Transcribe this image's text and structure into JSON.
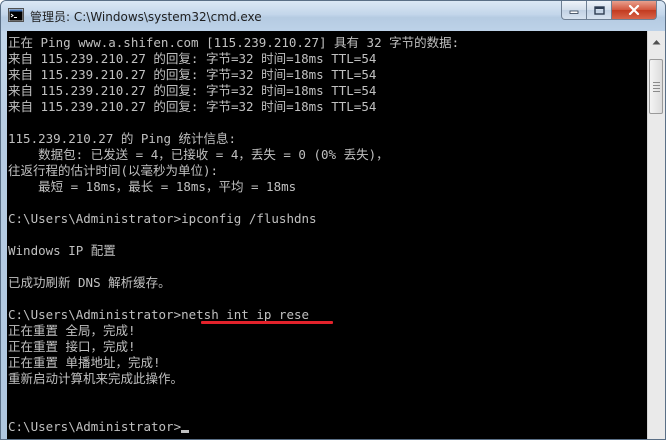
{
  "window": {
    "title": "管理员: C:\\Windows\\system32\\cmd.exe",
    "icon": "cmd-icon"
  },
  "title_buttons": {
    "minimize": "minimize-icon",
    "maximize": "maximize-icon",
    "close": "close-icon"
  },
  "console": {
    "lines": [
      "正在 Ping www.a.shifen.com [115.239.210.27] 具有 32 字节的数据:",
      "来自 115.239.210.27 的回复: 字节=32 时间=18ms TTL=54",
      "来自 115.239.210.27 的回复: 字节=32 时间=18ms TTL=54",
      "来自 115.239.210.27 的回复: 字节=32 时间=18ms TTL=54",
      "来自 115.239.210.27 的回复: 字节=32 时间=18ms TTL=54",
      "",
      "115.239.210.27 的 Ping 统计信息:",
      "    数据包: 已发送 = 4，已接收 = 4，丢失 = 0 (0% 丢失)，",
      "往返行程的估计时间(以毫秒为单位):",
      "    最短 = 18ms，最长 = 18ms，平均 = 18ms",
      "",
      "C:\\Users\\Administrator>ipconfig /flushdns",
      "",
      "Windows IP 配置",
      "",
      "已成功刷新 DNS 解析缓存。",
      "",
      "C:\\Users\\Administrator>netsh int ip rese",
      "正在重置 全局，完成!",
      "正在重置 接口，完成!",
      "正在重置 单播地址，完成!",
      "重新启动计算机来完成此操作。",
      "",
      "",
      "C:\\Users\\Administrator>"
    ]
  },
  "colors": {
    "console_bg": "#000000",
    "console_text": "#c0c0c0",
    "annotation": "#e3222b"
  }
}
